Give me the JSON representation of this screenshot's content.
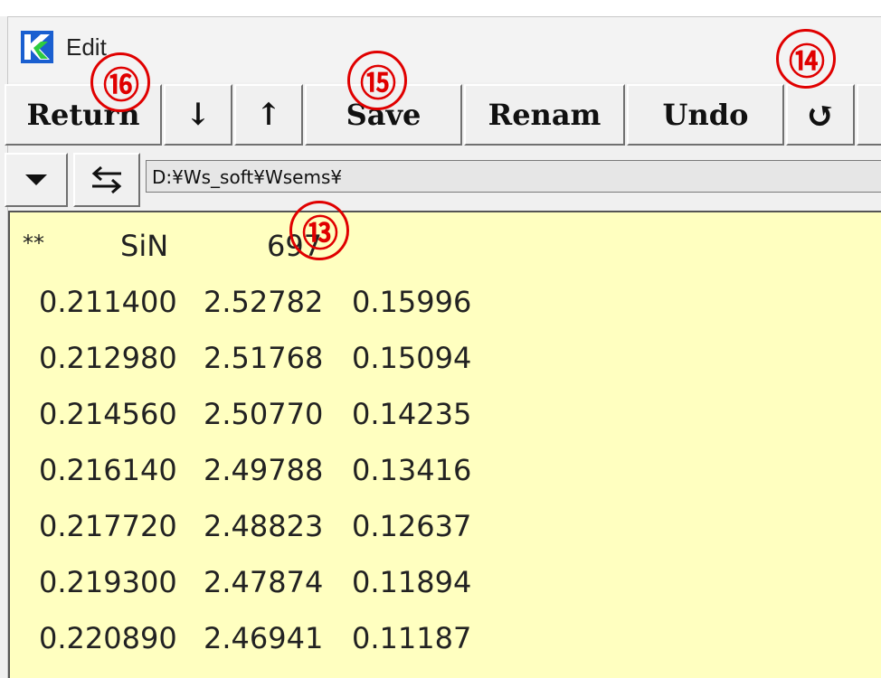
{
  "window": {
    "title": "Edit"
  },
  "toolbar": {
    "return_label": "Return",
    "down_label": "↓",
    "up_label": "↑",
    "save_label": "Save",
    "rename_label": "Renam",
    "undo_label": "Undo",
    "refresh_label": "↺"
  },
  "pathbar": {
    "dropdown_icon": "triangle-down-icon",
    "swap_icon": "swap-arrows-icon",
    "path": "D:¥Ws_soft¥Wsems¥"
  },
  "editor": {
    "header": [
      "**",
      "SiN",
      "697"
    ],
    "rows": [
      [
        "0.211400",
        "2.52782",
        "0.15996"
      ],
      [
        "0.212980",
        "2.51768",
        "0.15094"
      ],
      [
        "0.214560",
        "2.50770",
        "0.14235"
      ],
      [
        "0.216140",
        "2.49788",
        "0.13416"
      ],
      [
        "0.217720",
        "2.48823",
        "0.12637"
      ],
      [
        "0.219300",
        "2.47874",
        "0.11894"
      ],
      [
        "0.220890",
        "2.46941",
        "0.11187"
      ]
    ]
  },
  "annotations": [
    "⑯",
    "⑮",
    "⑭",
    "⑬"
  ],
  "colors": {
    "editor_bg": "#ffffc0",
    "annotation": "#e00000",
    "icon_blue": "#1a5fd0",
    "icon_green": "#2ecc40"
  }
}
